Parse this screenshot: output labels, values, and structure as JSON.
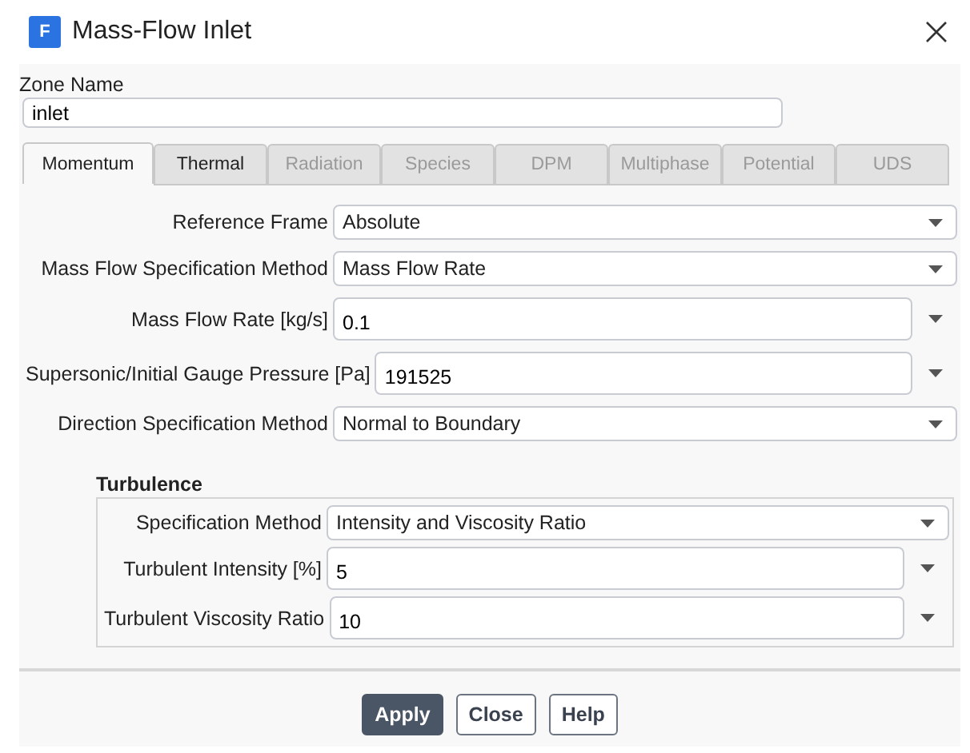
{
  "window": {
    "title": "Mass-Flow Inlet",
    "app_icon_letter": "F"
  },
  "zone_name": {
    "label": "Zone Name",
    "value": "inlet"
  },
  "tabs": [
    {
      "label": "Momentum",
      "selected": true,
      "disabled": false
    },
    {
      "label": "Thermal",
      "selected": false,
      "disabled": false
    },
    {
      "label": "Radiation",
      "selected": false,
      "disabled": true
    },
    {
      "label": "Species",
      "selected": false,
      "disabled": true
    },
    {
      "label": "DPM",
      "selected": false,
      "disabled": true
    },
    {
      "label": "Multiphase",
      "selected": false,
      "disabled": true
    },
    {
      "label": "Potential",
      "selected": false,
      "disabled": true
    },
    {
      "label": "UDS",
      "selected": false,
      "disabled": true
    }
  ],
  "fields": [
    {
      "kind": "select",
      "label": "Reference Frame",
      "value": "Absolute"
    },
    {
      "kind": "select",
      "label": "Mass Flow Specification Method",
      "value": "Mass Flow Rate"
    },
    {
      "kind": "input",
      "label": "Mass Flow Rate [kg/s]",
      "value": "0.1"
    },
    {
      "kind": "input",
      "label": "Supersonic/Initial Gauge Pressure [Pa]",
      "value": "191525"
    },
    {
      "kind": "select",
      "label": "Direction Specification Method",
      "value": "Normal to Boundary"
    }
  ],
  "turbulence": {
    "title": "Turbulence",
    "fields": [
      {
        "kind": "select",
        "label": "Specification Method",
        "value": "Intensity and Viscosity Ratio"
      },
      {
        "kind": "input",
        "label": "Turbulent Intensity [%]",
        "value": "5"
      },
      {
        "kind": "input",
        "label": "Turbulent Viscosity Ratio",
        "value": "10"
      }
    ]
  },
  "buttons": [
    {
      "label": "Apply",
      "primary": true
    },
    {
      "label": "Close",
      "primary": false
    },
    {
      "label": "Help",
      "primary": false
    }
  ]
}
